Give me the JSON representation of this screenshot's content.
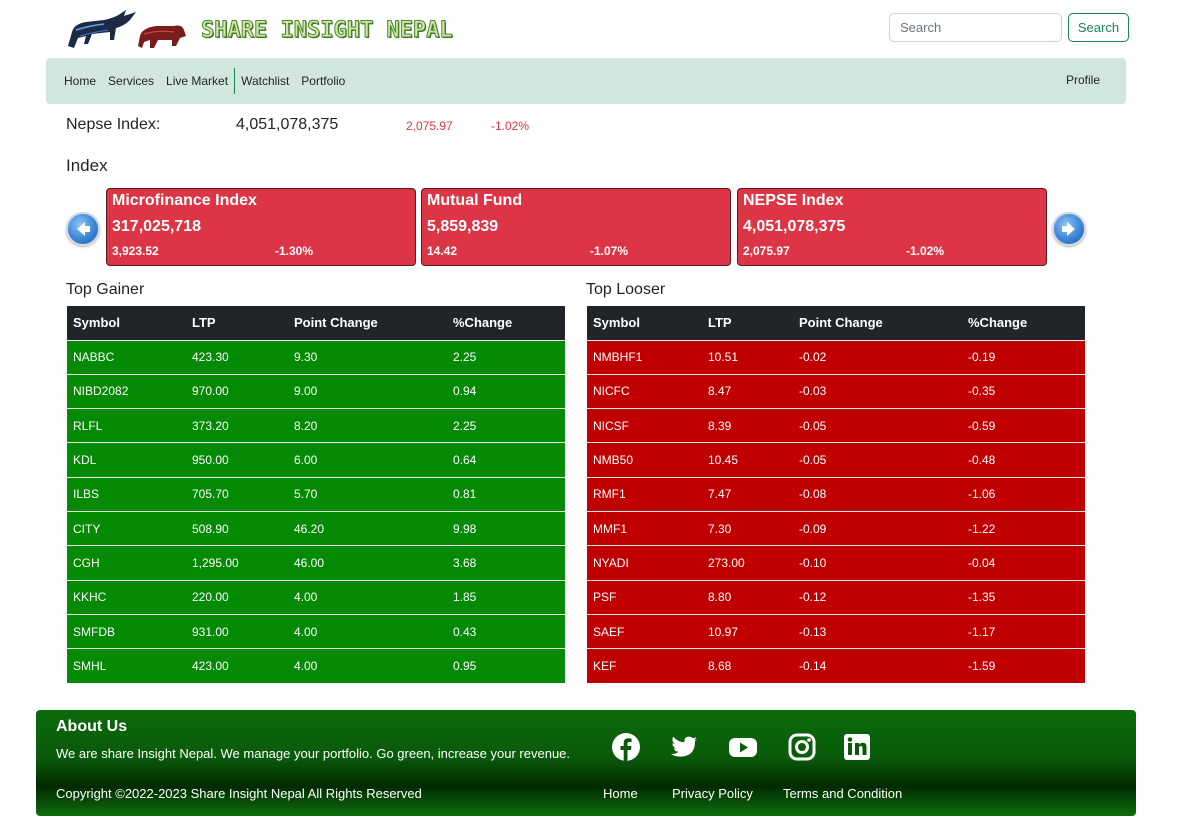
{
  "header": {
    "logo_text": "SHARE INSIGHT NEPAL",
    "search_placeholder": "Search",
    "search_button": "Search"
  },
  "nav": {
    "items": [
      "Home",
      "Services",
      "Live Market",
      "Watchlist",
      "Portfolio"
    ],
    "profile": "Profile"
  },
  "nepse": {
    "label": "Nepse Index:",
    "value": "4,051,078,375",
    "point_change": "2,075.97",
    "percent_change": "-1.02%"
  },
  "index_section": {
    "heading": "Index",
    "cards": [
      {
        "title": "Microfinance Index",
        "value": "317,025,718",
        "point": "3,923.52",
        "percent": "-1.30%"
      },
      {
        "title": "Mutual Fund",
        "value": "5,859,839",
        "point": "14.42",
        "percent": "-1.07%"
      },
      {
        "title": "NEPSE Index",
        "value": "4,051,078,375",
        "point": "2,075.97",
        "percent": "-1.02%"
      }
    ]
  },
  "top_gainer": {
    "title": "Top Gainer",
    "columns": [
      "Symbol",
      "LTP",
      "Point Change",
      "%Change"
    ],
    "rows": [
      [
        "NABBC",
        "423.30",
        "9.30",
        "2.25"
      ],
      [
        "NIBD2082",
        "970.00",
        "9.00",
        "0.94"
      ],
      [
        "RLFL",
        "373.20",
        "8.20",
        "2.25"
      ],
      [
        "KDL",
        "950.00",
        "6.00",
        "0.64"
      ],
      [
        "ILBS",
        "705.70",
        "5.70",
        "0.81"
      ],
      [
        "CITY",
        "508.90",
        "46.20",
        "9.98"
      ],
      [
        "CGH",
        "1,295.00",
        "46.00",
        "3.68"
      ],
      [
        "KKHC",
        "220.00",
        "4.00",
        "1.85"
      ],
      [
        "SMFDB",
        "931.00",
        "4.00",
        "0.43"
      ],
      [
        "SMHL",
        "423.00",
        "4.00",
        "0.95"
      ]
    ]
  },
  "top_looser": {
    "title": "Top Looser",
    "columns": [
      "Symbol",
      "LTP",
      "Point Change",
      "%Change"
    ],
    "rows": [
      [
        "NMBHF1",
        "10.51",
        "-0.02",
        "-0.19"
      ],
      [
        "NICFC",
        "8.47",
        "-0.03",
        "-0.35"
      ],
      [
        "NICSF",
        "8.39",
        "-0.05",
        "-0.59"
      ],
      [
        "NMB50",
        "10.45",
        "-0.05",
        "-0.48"
      ],
      [
        "RMF1",
        "7.47",
        "-0.08",
        "-1.06"
      ],
      [
        "MMF1",
        "7.30",
        "-0.09",
        "-1.22"
      ],
      [
        "NYADI",
        "273.00",
        "-0.10",
        "-0.04"
      ],
      [
        "PSF",
        "8.80",
        "-0.12",
        "-1.35"
      ],
      [
        "SAEF",
        "10.97",
        "-0.13",
        "-1.17"
      ],
      [
        "KEF",
        "8.68",
        "-0.14",
        "-1.59"
      ]
    ]
  },
  "footer": {
    "about_title": "About Us",
    "about_text": "We are share Insight Nepal. We manage your portfolio. Go green, increase your revenue.",
    "copyright": "Copyright ©2022-2023 Share Insight Nepal All Rights Reserved",
    "links": [
      "Home",
      "Privacy Policy",
      "Terms and Condition"
    ],
    "social_icons": [
      "facebook-icon",
      "twitter-icon",
      "youtube-icon",
      "instagram-icon",
      "linkedin-icon"
    ]
  },
  "colors": {
    "nav_bg": "#d1e7dd",
    "card_red": "#dc3545",
    "gainer_green": "#058a05",
    "looser_red": "#c00000",
    "table_header": "#212529",
    "footer_green": "#0a5a0a"
  }
}
